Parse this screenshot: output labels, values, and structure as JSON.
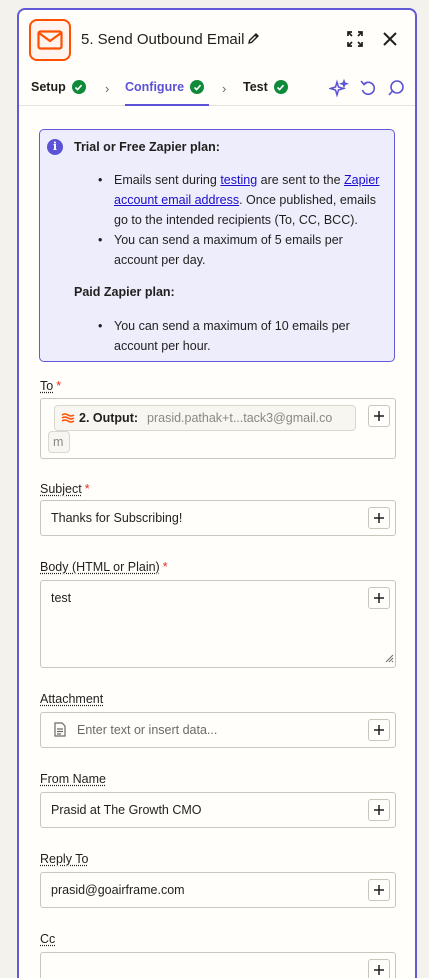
{
  "header": {
    "title": "5. Send Outbound Email",
    "app_icon": "email-envelope-icon",
    "accent_color": "#ff4f00"
  },
  "tabs": [
    {
      "label": "Setup",
      "status": "complete"
    },
    {
      "label": "Configure",
      "status": "complete",
      "active": true
    },
    {
      "label": "Test",
      "status": "complete"
    }
  ],
  "notice": {
    "trial_title": "Trial or Free Zapier plan:",
    "trial_items": [
      {
        "pre": "Emails sent during ",
        "link1": "testing",
        "mid": " are sent to the ",
        "link2": "Zapier account email address",
        "post": ". Once published, emails go to the intended recipients (To, CC, BCC)."
      },
      {
        "text": "You can send a maximum of 5 emails per account per day."
      }
    ],
    "paid_title": "Paid Zapier plan:",
    "paid_items": [
      "You can send a maximum of 10 emails per account per hour."
    ]
  },
  "fields": {
    "to": {
      "label": "To",
      "required": "*",
      "pill_label": "2. Output:",
      "pill_value": "prasid.pathak+t...tack3@gmail.co",
      "pill_overflow": "m"
    },
    "subject": {
      "label": "Subject",
      "required": "*",
      "value": "Thanks for Subscribing!"
    },
    "body": {
      "label": "Body (HTML or Plain)",
      "required": "*",
      "value": "test"
    },
    "attachment": {
      "label": "Attachment",
      "placeholder": "Enter text or insert data..."
    },
    "from_name": {
      "label": "From Name",
      "value": "Prasid at The Growth CMO"
    },
    "reply_to": {
      "label": "Reply To",
      "value": "prasid@goairframe.com"
    },
    "cc": {
      "label": "Cc"
    }
  }
}
